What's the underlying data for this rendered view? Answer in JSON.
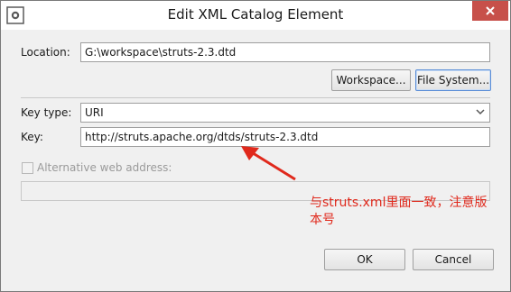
{
  "window": {
    "title": "Edit XML Catalog Element"
  },
  "location": {
    "label": "Location:",
    "value": "G:\\workspace\\struts-2.3.dtd"
  },
  "buttons": {
    "workspace": "Workspace...",
    "file_system": "File System...",
    "ok": "OK",
    "cancel": "Cancel"
  },
  "key_type": {
    "label": "Key type:",
    "selected": "URI"
  },
  "key": {
    "label": "Key:",
    "value": "http://struts.apache.org/dtds/struts-2.3.dtd"
  },
  "alt_address": {
    "label": "Alternative web address:",
    "value": "",
    "enabled": false
  },
  "annotation": {
    "text": "与struts.xml里面一致，注意版本号",
    "color": "#e0291c"
  },
  "icons": {
    "app": "eclipse-app-icon",
    "close": "close-icon",
    "dropdown": "chevron-down-icon"
  }
}
